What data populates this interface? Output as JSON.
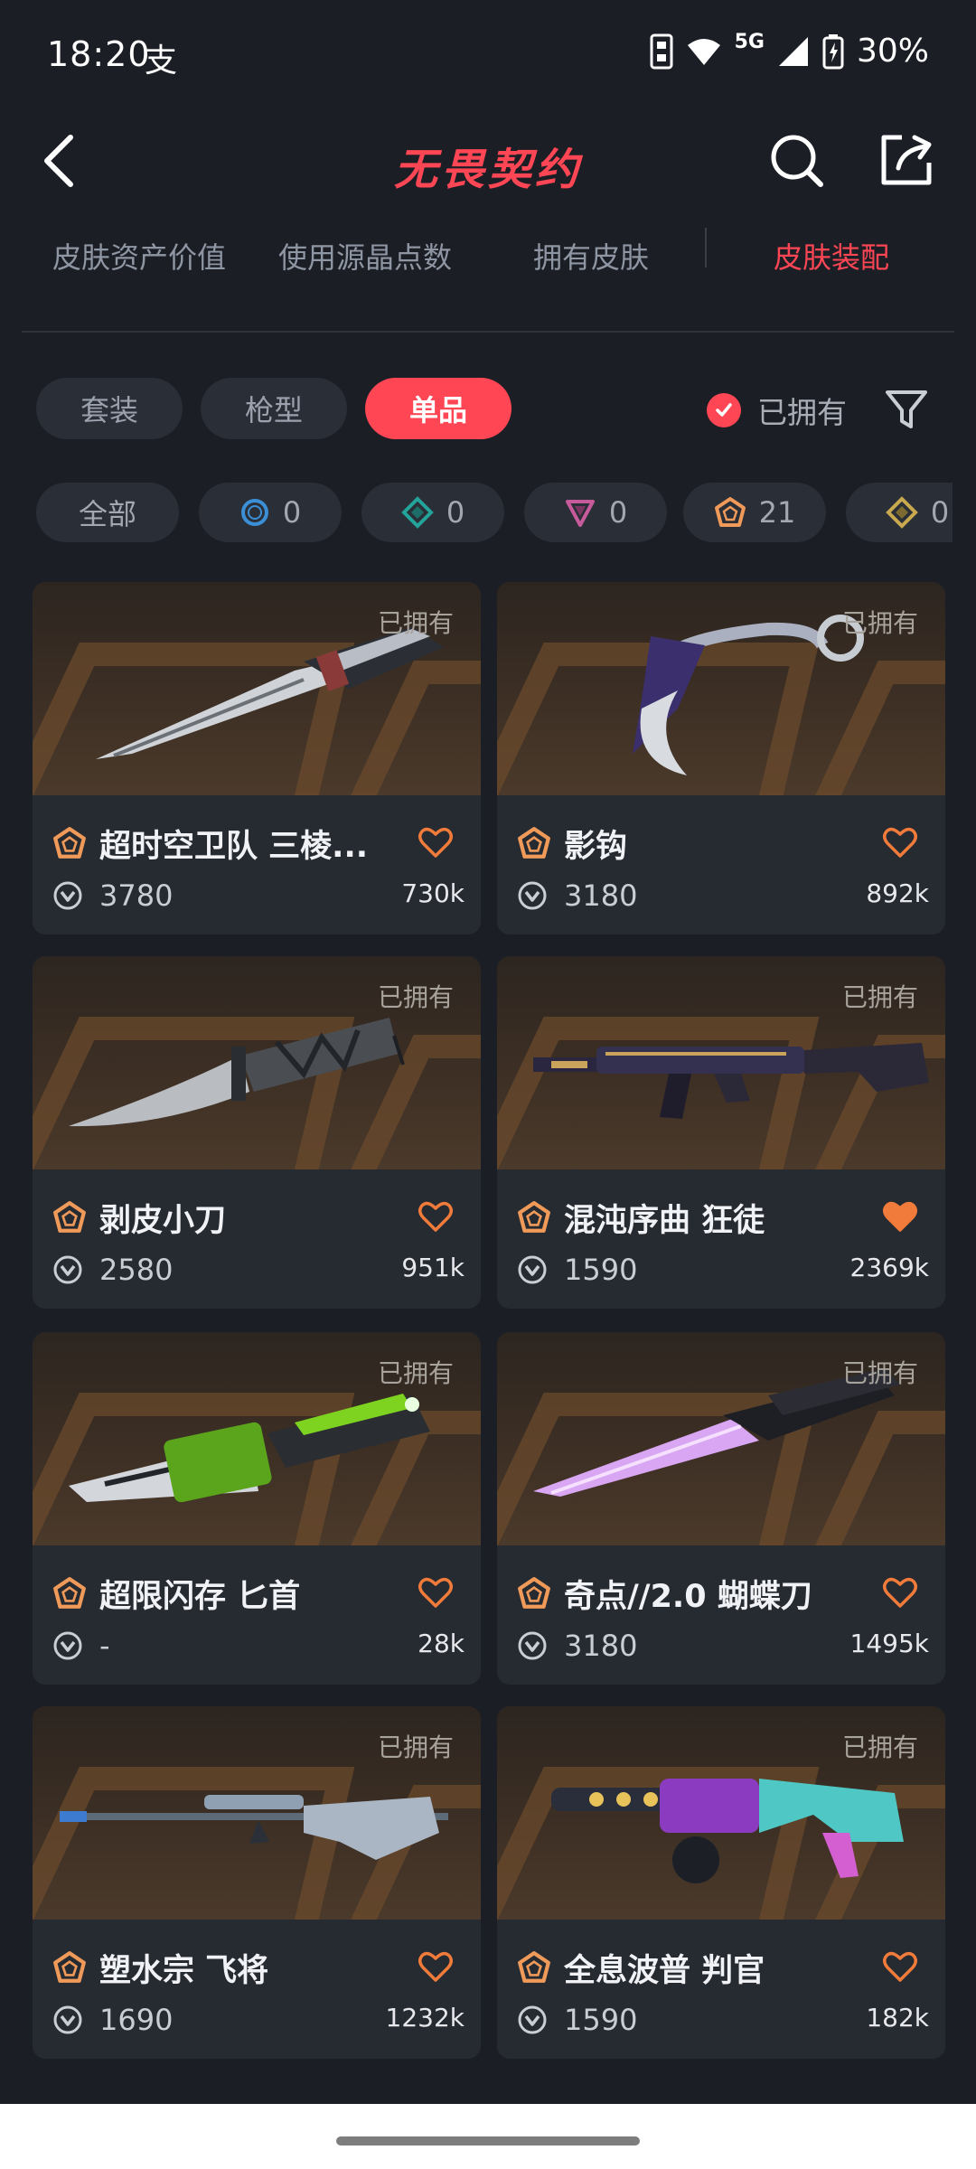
{
  "status_bar": {
    "time": "18:20",
    "app_glyph": "支",
    "network": "5G",
    "battery": "30%"
  },
  "header": {
    "title": "无畏契约",
    "back_icon": "back-arrow-icon",
    "search_icon": "search-icon",
    "share_icon": "share-icon"
  },
  "top_tabs": [
    {
      "label": "皮肤资产价值",
      "active": false
    },
    {
      "label": "使用源晶点数",
      "active": false
    },
    {
      "label": "拥有皮肤",
      "active": false
    },
    {
      "label": "皮肤装配",
      "active": true
    }
  ],
  "segments": [
    {
      "label": "套装",
      "active": false
    },
    {
      "label": "枪型",
      "active": false
    },
    {
      "label": "单品",
      "active": true
    }
  ],
  "owned_filter": {
    "label": "已拥有",
    "checked": true
  },
  "tiers": [
    {
      "label": "全部",
      "count": "",
      "color": ""
    },
    {
      "label": "",
      "count": "0",
      "color": "#3b8fd6"
    },
    {
      "label": "",
      "count": "0",
      "color": "#23a39a"
    },
    {
      "label": "",
      "count": "0",
      "color": "#c65a9b"
    },
    {
      "label": "",
      "count": "21",
      "color": "#f09a5a"
    },
    {
      "label": "",
      "count": "0",
      "color": "#c9a94e"
    }
  ],
  "items": [
    {
      "name": "超时空卫队 三棱...",
      "vp": "3780",
      "likes": "730k",
      "owned": "已拥有",
      "liked": false
    },
    {
      "name": "影钩",
      "vp": "3180",
      "likes": "892k",
      "owned": "已拥有",
      "liked": false
    },
    {
      "name": "剥皮小刀",
      "vp": "2580",
      "likes": "951k",
      "owned": "已拥有",
      "liked": false
    },
    {
      "name": "混沌序曲 狂徒",
      "vp": "1590",
      "likes": "2369k",
      "owned": "已拥有",
      "liked": true
    },
    {
      "name": "超限闪存 匕首",
      "vp": "-",
      "likes": "28k",
      "owned": "已拥有",
      "liked": false
    },
    {
      "name": "奇点//2.0 蝴蝶刀",
      "vp": "3180",
      "likes": "1495k",
      "owned": "已拥有",
      "liked": false
    },
    {
      "name": "塑水宗 飞将",
      "vp": "1690",
      "likes": "1232k",
      "owned": "已拥有",
      "liked": false
    },
    {
      "name": "全息波普 判官",
      "vp": "1590",
      "likes": "182k",
      "owned": "已拥有",
      "liked": false
    }
  ],
  "colors": {
    "accent": "#ff4655",
    "tier_exclusive": "#f09a5a",
    "background": "#1b1e25",
    "card": "#262a31"
  }
}
